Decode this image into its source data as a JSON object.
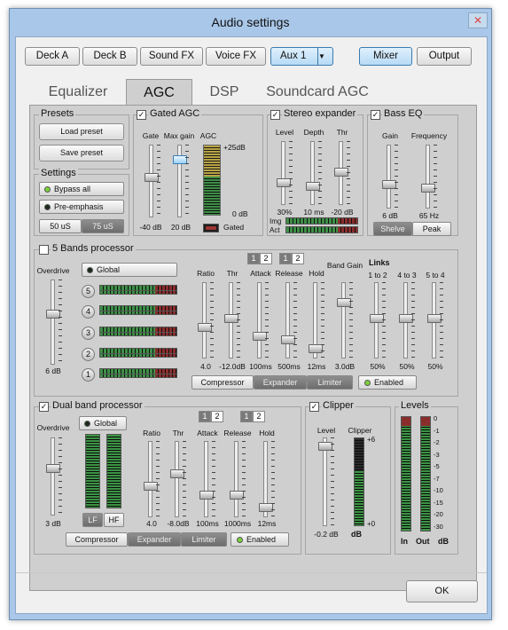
{
  "window": {
    "title": "Audio settings",
    "close": "✕"
  },
  "topbar": {
    "deck_a": "Deck A",
    "deck_b": "Deck B",
    "sound_fx": "Sound FX",
    "voice_fx": "Voice FX",
    "aux": "Aux 1",
    "mixer": "Mixer",
    "output": "Output"
  },
  "tabs": [
    "Equalizer",
    "AGC",
    "DSP",
    "Soundcard AGC"
  ],
  "presets": {
    "title": "Presets",
    "load": "Load preset",
    "save": "Save preset"
  },
  "settings": {
    "title": "Settings",
    "bypass": "Bypass all",
    "preemph": "Pre-emphasis",
    "opt1": "50 uS",
    "opt2": "75 uS"
  },
  "gated": {
    "title": "Gated AGC",
    "gate": "Gate",
    "maxgain": "Max gain",
    "agc": "AGC",
    "gate_val": "-40 dB",
    "maxgain_val": "20 dB",
    "top": "+25dB",
    "zero": "0 dB",
    "gated": "Gated"
  },
  "stereo": {
    "title": "Stereo expander",
    "level": "Level",
    "depth": "Depth",
    "thr": "Thr",
    "level_val": "30%",
    "depth_val": "10 ms",
    "thr_val": "-20 dB",
    "img": "Img",
    "act": "Act"
  },
  "bass": {
    "title": "Bass EQ",
    "gain": "Gain",
    "freq": "Frequency",
    "gain_val": "6 dB",
    "freq_val": "65 Hz",
    "shelve": "Shelve",
    "peak": "Peak"
  },
  "five": {
    "title": "5 Bands processor",
    "overdrive": "Overdrive",
    "od_val": "6 dB",
    "global": "Global",
    "bands": [
      "5",
      "4",
      "3",
      "2",
      "1"
    ],
    "sliders": [
      {
        "l": "Ratio",
        "v": "4.0"
      },
      {
        "l": "Thr",
        "v": "-12.0dB"
      },
      {
        "l": "Attack",
        "v": "100ms"
      },
      {
        "l": "Release",
        "v": "500ms"
      },
      {
        "l": "Hold",
        "v": "12ms"
      },
      {
        "l": "Band Gain",
        "v": "3.0dB"
      }
    ],
    "links": "Links",
    "link_sliders": [
      {
        "l": "1 to 2",
        "v": "50%"
      },
      {
        "l": "4 to 3",
        "v": "50%"
      },
      {
        "l": "5 to 4",
        "v": "50%"
      }
    ],
    "n1": "1",
    "n2": "2",
    "compressor": "Compressor",
    "expander": "Expander",
    "limiter": "Limiter",
    "enabled": "Enabled"
  },
  "dual": {
    "title": "Dual band processor",
    "overdrive": "Overdrive",
    "od_val": "3 dB",
    "global": "Global",
    "lf": "LF",
    "hf": "HF",
    "sliders": [
      {
        "l": "Ratio",
        "v": "4.0"
      },
      {
        "l": "Thr",
        "v": "-8.0dB"
      },
      {
        "l": "Attack",
        "v": "100ms"
      },
      {
        "l": "Release",
        "v": "1000ms"
      },
      {
        "l": "Hold",
        "v": "12ms"
      }
    ],
    "n1": "1",
    "n2": "2",
    "compressor": "Compressor",
    "expander": "Expander",
    "limiter": "Limiter",
    "enabled": "Enabled"
  },
  "clipper": {
    "title": "Clipper",
    "level": "Level",
    "clipper": "Clipper",
    "level_val": "-0.2 dB",
    "top": "+6",
    "zero": "+0",
    "db": "dB"
  },
  "levels": {
    "title": "Levels",
    "scale": [
      "0",
      "-1",
      "-2",
      "-3",
      "-5",
      "-7",
      "-10",
      "-15",
      "-20",
      "-30"
    ],
    "in": "In",
    "out": "Out",
    "db": "dB"
  },
  "ok": "OK"
}
